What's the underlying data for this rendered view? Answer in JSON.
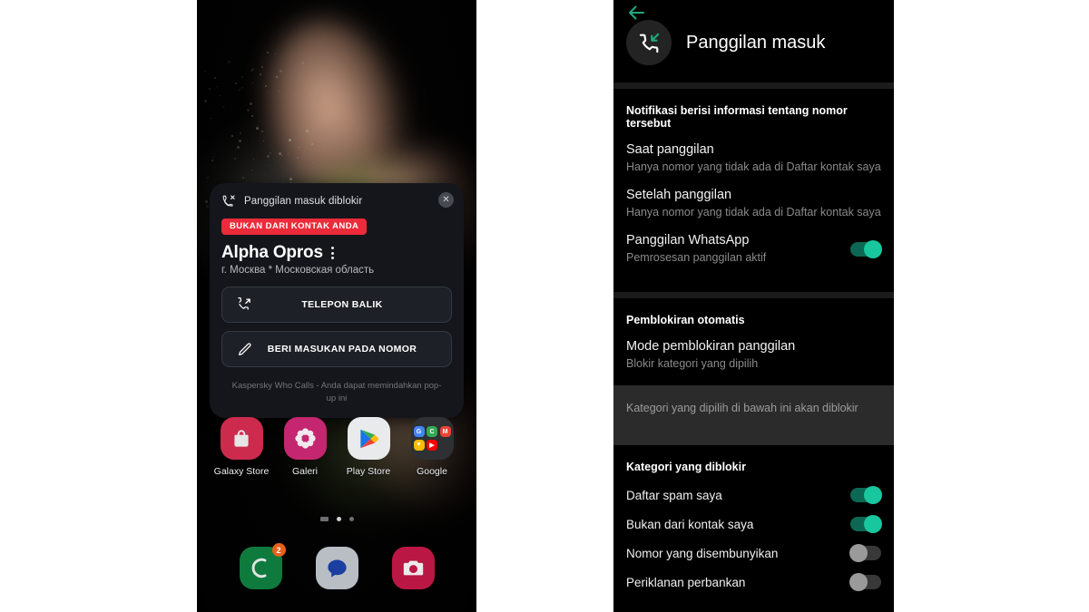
{
  "phone": {
    "popup": {
      "header_icon": "missed-call-icon",
      "header_title": "Panggilan masuk diblokir",
      "close_icon": "close-icon",
      "badge_label": "BUKAN DARI KONTAK ANDA",
      "caller_name": "Alpha Opros",
      "kebab_icon": "more-vertical-icon",
      "caller_location": "г. Москва * Московская область",
      "buttons": [
        {
          "icon": "call-back-icon",
          "label": "TELEPON BALIK"
        },
        {
          "icon": "pencil-icon",
          "label": "BERI MASUKAN PADA NOMOR"
        }
      ],
      "footer": "Kaspersky Who Calls - Anda dapat memindahkan pop-up ini"
    },
    "apps": [
      {
        "label": "Galaxy Store",
        "icon": "shopping-bag-icon",
        "color": "#cc2b4e"
      },
      {
        "label": "Galeri",
        "icon": "flower-icon",
        "color": "#c4266f"
      },
      {
        "label": "Play Store",
        "icon": "play-triangle-icon",
        "color": "#e9eaec"
      },
      {
        "label": "Google",
        "icon": "folder-google-icon",
        "color": "#2e3033"
      }
    ],
    "google_folder_minis": [
      {
        "glyph": "G",
        "color": "#4285f4"
      },
      {
        "glyph": "C",
        "color": "#34a853"
      },
      {
        "glyph": "M",
        "color": "#ea4335"
      },
      {
        "glyph": "♥",
        "color": "#fbbc05"
      },
      {
        "glyph": "▶",
        "color": "#ff0000"
      }
    ],
    "dock": [
      {
        "label": "Contacts",
        "icon": "contacts-icon",
        "badge": "2"
      },
      {
        "label": "Messages",
        "icon": "message-bubble-icon",
        "badge": ""
      },
      {
        "label": "Camera",
        "icon": "camera-icon",
        "badge": ""
      }
    ],
    "page_indicator": {
      "dots": 3,
      "active_index": 1
    }
  },
  "settings": {
    "back_icon": "back-arrow-icon",
    "header_icon": "incoming-call-icon",
    "header_title": "Panggilan masuk",
    "section_notification": {
      "title": "Notifikasi berisi informasi tentang nomor tersebut",
      "rows": [
        {
          "title": "Saat panggilan",
          "sub": "Hanya nomor yang tidak ada di Daftar kontak saya",
          "toggle": null
        },
        {
          "title": "Setelah panggilan",
          "sub": "Hanya nomor yang tidak ada di Daftar kontak saya",
          "toggle": null
        },
        {
          "title": "Panggilan WhatsApp",
          "sub": "Pemrosesan panggilan aktif",
          "toggle": "on"
        }
      ]
    },
    "section_autoblock": {
      "title": "Pemblokiran otomatis",
      "rows": [
        {
          "title": "Mode pemblokiran panggilan",
          "sub": "Blokir kategori yang dipilih",
          "toggle": null
        }
      ],
      "note": "Kategori yang dipilih di bawah ini akan diblokir"
    },
    "section_blocked": {
      "title": "Kategori yang diblokir",
      "items": [
        {
          "label": "Daftar spam saya",
          "toggle": "on"
        },
        {
          "label": "Bukan dari kontak saya",
          "toggle": "on"
        },
        {
          "label": "Nomor yang disembunyikan",
          "toggle": "off"
        },
        {
          "label": "Periklanan perbankan",
          "toggle": "off"
        }
      ]
    }
  },
  "colors": {
    "accent_teal": "#18c79e",
    "badge_red": "#ec2b3a",
    "panel_bg": "#000000",
    "card_bg": "#14161c",
    "note_band": "#2b2b2b"
  }
}
